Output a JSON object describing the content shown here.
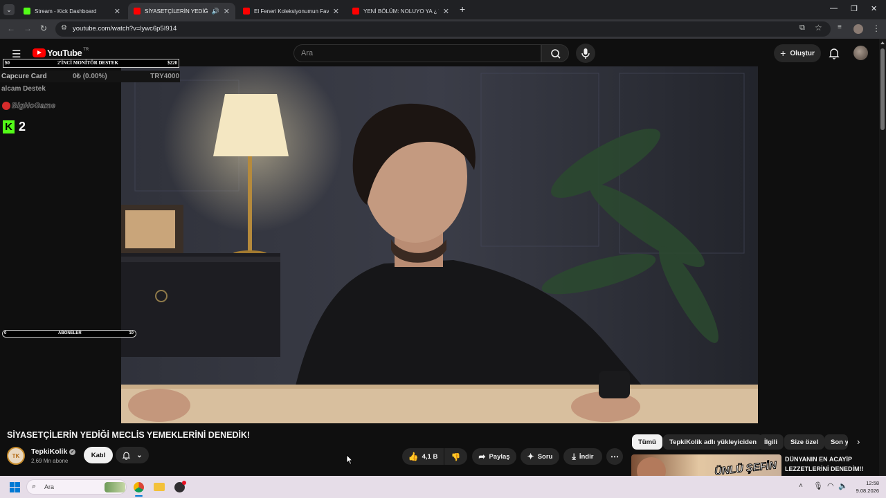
{
  "browser": {
    "tabs": [
      {
        "title": "Stream - Kick Dashboard",
        "favicon_color": "#53fc18",
        "active": false
      },
      {
        "title": "SİYASETÇİLERİN YEDİĞİ ME",
        "favicon_color": "#ff0000",
        "active": true
      },
      {
        "title": "El Feneri Koleksiyonumun Favo",
        "favicon_color": "#ff0000",
        "active": false
      },
      {
        "title": "YENİ BÖLÜM: NOLUYO YA ¿ VS",
        "favicon_color": "#ff0000",
        "active": false
      }
    ],
    "new_tab": "+",
    "url": "youtube.com/watch?v=lywc6p5I914"
  },
  "youtube": {
    "logo": "YouTube",
    "region": "TR",
    "search_placeholder": "Ara",
    "create_label": "Oluştur",
    "video_title": "SİYASETÇİLERİN YEDİĞİ MECLİS YEMEKLERİNİ DENEDİK!",
    "channel": {
      "name": "TepkiKolik",
      "subscribers": "2,69 Mn abone",
      "avatar_text": "TK"
    },
    "join_label": "Katıl",
    "actions": {
      "like_count": "4,1 B",
      "share": "Paylaş",
      "ask": "Soru",
      "download": "İndir"
    },
    "chips": [
      "Tümü",
      "TepkiKolik adlı yükleyiciden",
      "İlgili",
      "Size özel",
      "Son y"
    ],
    "recommended": {
      "title_line1": "DÜNYANIN EN ACAYİP",
      "title_line2": "LEZZETLERİNİ DENEDİM!!",
      "thumb_text": "ÜNLÜ ŞEFİN"
    }
  },
  "overlay": {
    "goal_left": "$0",
    "goal_title": "2'İNCİ MONİTÖR DESTEK",
    "goal_right": "$220",
    "goal_progress": 0,
    "capcure_label": "Capcure Card",
    "capcure_value": "0₺ (0.00%)",
    "capcure_target": "TRY4000",
    "capcure_line2": "alcam Destek",
    "brand": "BigNoGame",
    "kick_count": "2",
    "subs_left": "0",
    "subs_label": "ABONELER",
    "subs_right": "10",
    "subs_progress": 0
  },
  "taskbar": {
    "search_placeholder": "Ara",
    "time": "12:58",
    "date": "9.08.2026"
  },
  "colors": {
    "youtube_red": "#ff0000",
    "kick_green": "#53fc18",
    "chrome_dark": "#202124"
  }
}
